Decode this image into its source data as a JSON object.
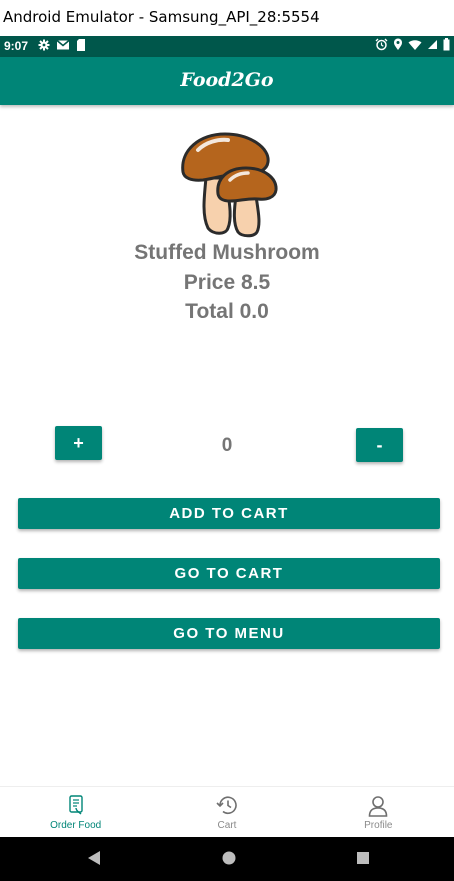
{
  "window": {
    "title": "Android Emulator - Samsung_API_28:5554"
  },
  "status_bar": {
    "time": "9:07"
  },
  "app_bar": {
    "title": "Food2Go"
  },
  "food": {
    "name": "Stuffed Mushroom",
    "price_text": "Price 8.5",
    "total_text": "Total 0.0",
    "image_icon": "mushroom-image"
  },
  "quantity": {
    "increment_label": "+",
    "value": "0",
    "decrement_label": "-"
  },
  "actions": {
    "add_to_cart": "ADD TO CART",
    "go_to_cart": "GO TO CART",
    "go_to_menu": "GO TO MENU"
  },
  "bottom_nav": {
    "items": [
      {
        "label": "Order Food",
        "icon": "order-food-icon",
        "active": true
      },
      {
        "label": "Cart",
        "icon": "history-icon",
        "active": false
      },
      {
        "label": "Profile",
        "icon": "person-icon",
        "active": false
      }
    ]
  },
  "colors": {
    "primary": "#008577",
    "primary_dark": "#00574b",
    "text_gray": "#757575"
  }
}
